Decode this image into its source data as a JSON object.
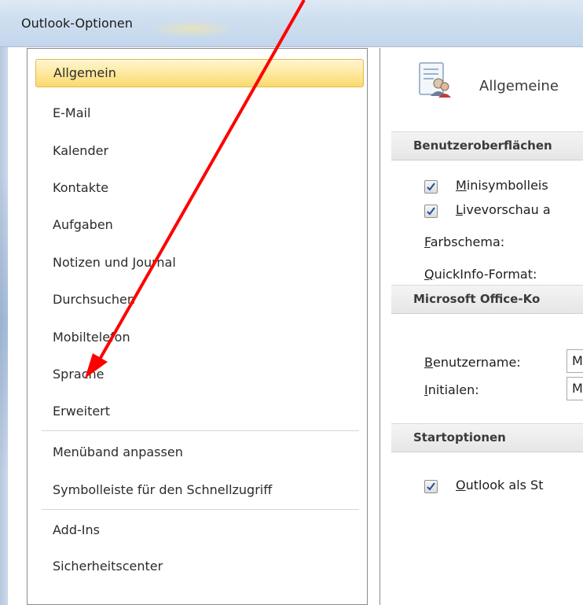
{
  "window": {
    "title": "Outlook-Optionen"
  },
  "nav": {
    "items": [
      {
        "label": "Allgemein",
        "selected": true
      },
      {
        "label": "E-Mail"
      },
      {
        "label": "Kalender"
      },
      {
        "label": "Kontakte"
      },
      {
        "label": "Aufgaben"
      },
      {
        "label": "Notizen und Journal"
      },
      {
        "label": "Durchsuchen"
      },
      {
        "label": "Mobiltelefon"
      },
      {
        "label": "Sprache"
      },
      {
        "label": "Erweitert"
      },
      {
        "label": "Menüband anpassen"
      },
      {
        "label": "Symbolleiste für den Schnellzugriff"
      },
      {
        "label": "Add-Ins"
      },
      {
        "label": "Sicherheitscenter"
      }
    ]
  },
  "main": {
    "heading": "Allgemeine",
    "sections": {
      "ui": {
        "title": "Benutzeroberflächen",
        "minitoolbar": {
          "label_first": "M",
          "label_rest": "inisymbolleis",
          "checked": true
        },
        "livepreview": {
          "label_first": "L",
          "label_rest": "ivevorschau a",
          "checked": true
        },
        "colorscheme": {
          "label_first": "F",
          "label_rest": "arbschema:"
        },
        "tooltip": {
          "label_first": "Q",
          "label_rest": "uickInfo-Format:"
        }
      },
      "office": {
        "title": "Microsoft Office-Ko",
        "username": {
          "label_first": "B",
          "label_rest": "enutzername:",
          "value": "M"
        },
        "initials": {
          "label_first": "I",
          "label_rest": "nitialen:",
          "value": "M"
        }
      },
      "startup": {
        "title": "Startoptionen",
        "outlook_default": {
          "label_first": "O",
          "label_rest": "utlook als St",
          "checked": true
        }
      }
    }
  },
  "colors": {
    "selected_fill": "#fde79a",
    "selected_border": "#e3b94a",
    "annotation_arrow": "#ff0000",
    "checkmark": "#1f4f9a"
  }
}
